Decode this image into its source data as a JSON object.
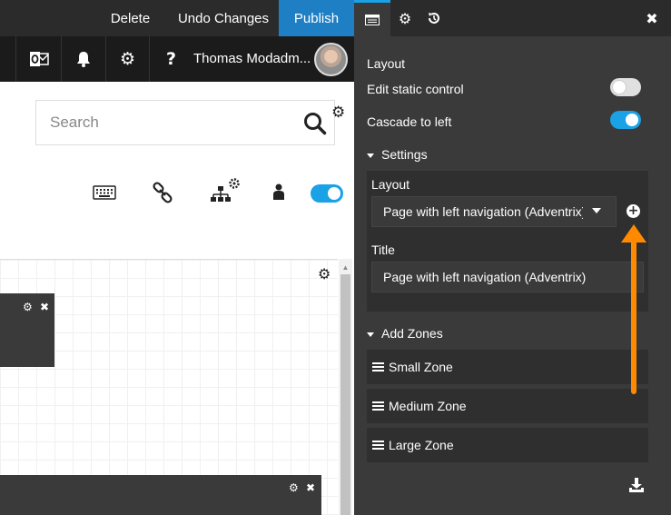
{
  "toolbar": {
    "delete_label": "Delete",
    "undo_label": "Undo Changes",
    "publish_label": "Publish"
  },
  "header": {
    "icons": [
      "outlook-icon",
      "bell-icon",
      "gear-icon",
      "help-icon"
    ],
    "help_glyph": "?",
    "user_name": "Thomas Modadm..."
  },
  "search": {
    "placeholder": "Search"
  },
  "canvas": {
    "close_glyph": "✖"
  },
  "panel": {
    "tab_close_glyph": "✖",
    "layout_label": "Layout",
    "edit_static_label": "Edit static control",
    "edit_static_on": false,
    "cascade_label": "Cascade to left",
    "cascade_on": true,
    "settings": {
      "heading": "Settings",
      "layout_field_label": "Layout",
      "layout_value": "Page with left navigation (Adventrix)",
      "add_glyph": "+",
      "title_field_label": "Title",
      "title_value": "Page with left navigation (Adventrix)"
    },
    "zones": {
      "heading": "Add Zones",
      "items": [
        "Small Zone",
        "Medium Zone",
        "Large Zone"
      ]
    }
  },
  "colors": {
    "accent": "#1aa1e6",
    "publish": "#1f7fc5",
    "panel_bg": "#3a3a3a",
    "annotation_arrow": "#ff8a00"
  }
}
